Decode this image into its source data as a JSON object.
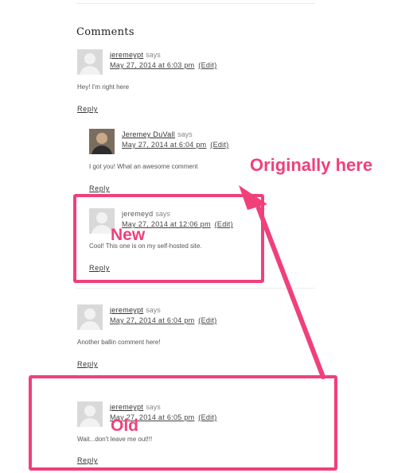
{
  "comments_heading": "Comments",
  "comments": [
    {
      "author": "jeremeypt",
      "says": "says",
      "date": "May 27, 2014 at 6:03 pm",
      "edit": "(Edit)",
      "text": "Hey! I'm right here",
      "reply": "Reply"
    },
    {
      "author": "Jeremey DuVall",
      "says": "says",
      "date": "May 27, 2014 at 6:04 pm",
      "edit": "(Edit)",
      "text": "I got you! What an awesome comment",
      "reply": "Reply"
    },
    {
      "author": "jeremeyd",
      "says": "says",
      "date": "May 27, 2014 at 12:06 pm",
      "edit": "(Edit)",
      "text": "Cool! This one is on my self-hosted site.",
      "reply": "Reply"
    },
    {
      "author": "jeremeypt",
      "says": "says",
      "date": "May 27, 2014 at 6:04 pm",
      "edit": "(Edit)",
      "text": "Another ballin comment here!",
      "reply": "Reply"
    },
    {
      "author": "jeremeypt",
      "says": "says",
      "date": "May 27, 2014 at 6:05 pm",
      "edit": "(Edit)",
      "text": "Wait...don't leave me out!!!",
      "reply": "Reply"
    }
  ],
  "annotations": {
    "originally_here": "Originally here",
    "new": "New",
    "old": "Old"
  },
  "colors": {
    "annotation": "#f0407a"
  }
}
